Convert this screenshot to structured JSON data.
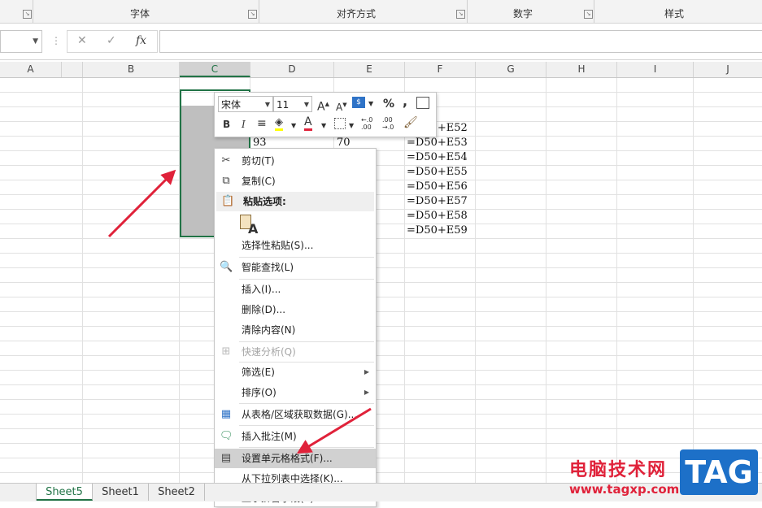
{
  "ribbon": {
    "groups": [
      {
        "label": "字体"
      },
      {
        "label": "对齐方式"
      },
      {
        "label": "数字"
      },
      {
        "label": "样式"
      }
    ]
  },
  "formula_bar": {
    "cancel_icon": "✕",
    "enter_icon": "✓",
    "fx_label": "fx",
    "value": ""
  },
  "columns": [
    "A",
    "B",
    "C",
    "D",
    "E",
    "F",
    "G",
    "H",
    "I",
    "J"
  ],
  "cells": {
    "d_row1": "93",
    "e_row1": "70",
    "f_values": [
      "=D50+E52",
      "=D50+E53",
      "=D50+E54",
      "=D50+E55",
      "=D50+E56",
      "=D50+E57",
      "=D50+E58",
      "=D50+E59"
    ]
  },
  "mini_toolbar": {
    "font_name": "宋体",
    "font_size": "11",
    "grow_font": "A",
    "shrink_font": "A",
    "percent": "%",
    "comma": ",",
    "bold": "B",
    "italic": "I",
    "font_color": "A",
    "increase_decimal": "←.0 .00",
    "decrease_decimal": ".00 →.0"
  },
  "context_menu": {
    "items": [
      {
        "label": "剪切(T)",
        "icon": "scissors-icon"
      },
      {
        "label": "复制(C)",
        "icon": "copy-icon"
      },
      {
        "label": "粘贴选项:",
        "icon": "paste-icon"
      },
      {
        "label": "选择性粘贴(S)...",
        "icon": ""
      },
      {
        "label": "智能查找(L)",
        "icon": "search-icon"
      },
      {
        "label": "插入(I)...",
        "icon": ""
      },
      {
        "label": "删除(D)...",
        "icon": ""
      },
      {
        "label": "清除内容(N)",
        "icon": ""
      },
      {
        "label": "快速分析(Q)",
        "icon": "quick-analysis-icon"
      },
      {
        "label": "筛选(E)",
        "icon": ""
      },
      {
        "label": "排序(O)",
        "icon": ""
      },
      {
        "label": "从表格/区域获取数据(G)...",
        "icon": "table-icon"
      },
      {
        "label": "插入批注(M)",
        "icon": "comment-icon"
      },
      {
        "label": "设置单元格格式(F)...",
        "icon": "format-cells-icon"
      },
      {
        "label": "从下拉列表中选择(K)...",
        "icon": ""
      },
      {
        "label": "显示拼音字段(S)",
        "icon": "phonetic-icon"
      }
    ],
    "paste_glyph": "A"
  },
  "sheet_tabs": [
    "Sheet5",
    "Sheet1",
    "Sheet2"
  ],
  "watermark": {
    "title": "电脑技术网",
    "url": "www.tagxp.com",
    "tag": "TAG"
  },
  "colors": {
    "accent_green": "#217346",
    "arrow_red": "#e0223a",
    "tag_blue": "#1d70c8"
  }
}
